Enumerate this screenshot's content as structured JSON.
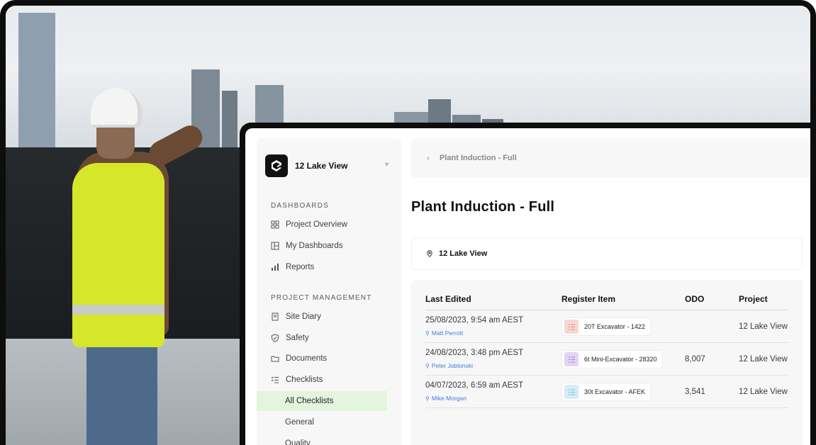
{
  "sidebar": {
    "project_name": "12 Lake View",
    "dashboards_label": "DASHBOARDS",
    "dashboards": [
      {
        "label": "Project Overview",
        "icon": "grid-icon"
      },
      {
        "label": "My Dashboards",
        "icon": "layout-icon"
      },
      {
        "label": "Reports",
        "icon": "chart-icon"
      }
    ],
    "pm_label": "PROJECT MANAGEMENT",
    "pm_items": [
      {
        "label": "Site Diary",
        "icon": "book-icon"
      },
      {
        "label": "Safety",
        "icon": "shield-icon"
      },
      {
        "label": "Documents",
        "icon": "folder-icon"
      },
      {
        "label": "Checklists",
        "icon": "checklist-icon"
      }
    ],
    "checklist_sub": [
      {
        "label": "All Checklists",
        "active": true
      },
      {
        "label": "General",
        "active": false
      },
      {
        "label": "Quality",
        "active": false
      }
    ]
  },
  "breadcrumb": {
    "label": "Plant Induction - Full"
  },
  "page": {
    "title": "Plant Induction - Full",
    "location": "12 Lake View"
  },
  "table": {
    "headers": [
      "Last Edited",
      "Register Item",
      "ODO",
      "Project"
    ],
    "rows": [
      {
        "date": "25/08/2023, 9:54 am AEST",
        "user": "Matt Perrott",
        "item": "20T Excavator - 1422",
        "item_color": "#f8d7d3",
        "item_icon_color": "#e08a80",
        "odo": "",
        "project": "12 Lake View"
      },
      {
        "date": "24/08/2023, 3:48 pm AEST",
        "user": "Peter Jablonski",
        "item": "6t Mini-Excavator - 28320",
        "item_color": "#e4d3f6",
        "item_icon_color": "#a67fd9",
        "odo": "8,007",
        "project": "12 Lake View"
      },
      {
        "date": "04/07/2023, 6:59 am AEST",
        "user": "Mike Morgan",
        "item": "30t Excavator - AFEK",
        "item_color": "#d6ecf7",
        "item_icon_color": "#7fb8d9",
        "odo": "3,541",
        "project": "12 Lake View"
      }
    ]
  },
  "colors": {
    "active_nav_bg": "#e3f5dc",
    "user_link": "#3f7fd9",
    "vest": "#d6e62a"
  }
}
